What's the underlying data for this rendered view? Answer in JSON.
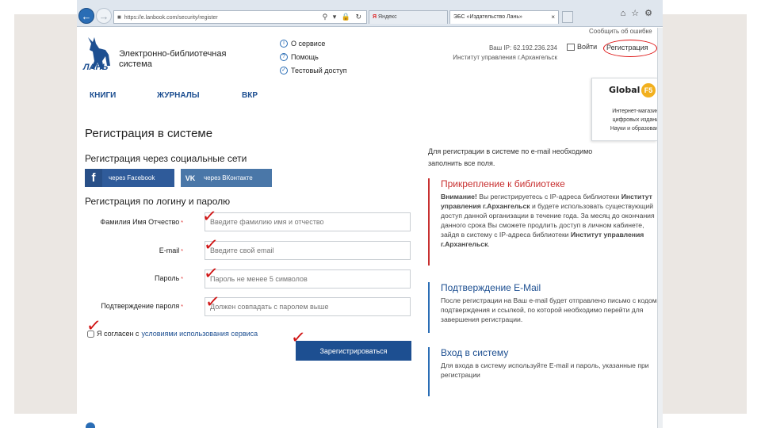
{
  "browser": {
    "address": "https://e.lanbook.com/security/register",
    "tab1_label": "Яндекс",
    "tab2_label": "ЭБС «Издательство Лань»"
  },
  "header": {
    "logo_text": "ЛАНЬ",
    "site_name": "Электронно-библиотечная система",
    "links": [
      "О сервисе",
      "Помощь",
      "Тестовый доступ"
    ],
    "ip_line1": "Ваш IP: 62.192.236.234",
    "ip_line2": "Институт управления г.Архангельск",
    "report": "Сообщить об ошибке",
    "login": "Войти",
    "register": "Регистрация"
  },
  "menu": [
    "КНИГИ",
    "ЖУРНАЛЫ",
    "ВКР"
  ],
  "promo": {
    "logo": "Global",
    "badge": "F5",
    "lines": [
      "Интернет-магазин",
      "цифровых издани",
      "Науки и образован"
    ]
  },
  "form": {
    "title": "Регистрация в системе",
    "social_title": "Регистрация через социальные сети",
    "facebook": "через Facebook",
    "vk": "через ВКонтакте",
    "login_title": "Регистрация по логину и паролю",
    "fields": [
      {
        "label": "Фамилия Имя Отчество",
        "placeholder": "Введите фамилию имя и отчество"
      },
      {
        "label": "E-mail",
        "placeholder": "Введите свой email"
      },
      {
        "label": "Пароль",
        "placeholder": "Пароль не менее 5 символов"
      },
      {
        "label": "Подтверждение пароля",
        "placeholder": "Должен совпадать с паролем выше"
      }
    ],
    "required_mark": "*",
    "agree_prefix": "Я согласен с",
    "agree_link": "условиями использования сервиса",
    "submit": "Зарегистрироваться"
  },
  "info": {
    "intro": "Для регистрации в системе по e-mail необходимо заполнить все поля.",
    "library_title": "Прикрепление к библиотеке",
    "library_attention": "Внимание!",
    "library_text1": " Вы регистрируетесь с IP-адреса библиотеки ",
    "library_name": "Институт управления г.Архангельск",
    "library_text2": " и будете использовать существующий доступ данной организации в течение года. За месяц до окончания данного срока Вы сможете продлить доступ в личном кабинете, зайдя в систему с IP-адреса библиотеки ",
    "library_name2": "Институт управления г.Архангельск",
    "library_end": ".",
    "email_title": "Подтверждение E-Mail",
    "email_text": "После регистрации на Ваш e-mail будет отправлено письмо с кодом подтверждения и ссылкой, по которой необходимо перейти для завершения регистрации.",
    "login_title": "Вход в систему",
    "login_text": "Для входа в систему используйте E-mail и пароль, указанные при регистрации"
  },
  "colors": {
    "brand": "#1d4f91",
    "annotation_red": "#d01414",
    "library_accent": "#c83030"
  }
}
